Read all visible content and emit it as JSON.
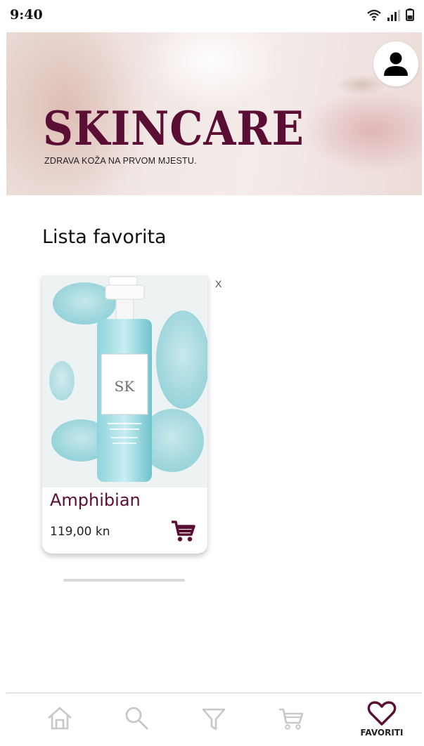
{
  "status_bar": {
    "time": "9:40"
  },
  "header": {
    "brand": "SKINCARE",
    "tagline": "ZDRAVA KOŽA NA PRVOM MJESTU.",
    "profile_icon": "person-icon"
  },
  "favorites": {
    "title": "Lista favorita",
    "remove_label": "X",
    "items": [
      {
        "name": "Amphibian",
        "price": "119,00 kn",
        "image_label": "SK"
      }
    ]
  },
  "bottom_nav": {
    "items": [
      {
        "icon": "home-icon",
        "label": ""
      },
      {
        "icon": "search-icon",
        "label": ""
      },
      {
        "icon": "filter-icon",
        "label": ""
      },
      {
        "icon": "cart-icon",
        "label": ""
      },
      {
        "icon": "heart-icon",
        "label": "FAVORITI",
        "active": true
      }
    ]
  },
  "colors": {
    "brand": "#5b0e34",
    "inactive_icon": "#c8c8c8"
  }
}
